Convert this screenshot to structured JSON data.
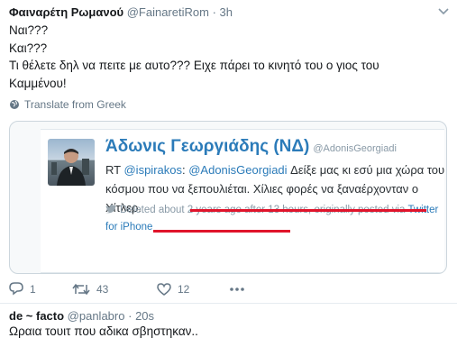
{
  "tweet1": {
    "name": "Φαιναρέτη Ρωμανού",
    "handle": "@FainaretiRom",
    "separator": "·",
    "time": "3h",
    "lines": [
      "Ναι???",
      "Και???",
      "Τι θέλετε δηλ να πειτε με αυτο??? Ειχε πάρει το κινητό του ο γιος του",
      "Καμμένου!"
    ],
    "translate": "Translate from Greek",
    "embedded": {
      "name": "Άδωνις Γεωργιάδης (ΝΔ)",
      "handle": "@AdonisGeorgiadi",
      "rt_prefix": "RT",
      "mention1": "@ispirakos",
      "colon": ":",
      "mention2": "@AdonisGeorgiadi",
      "text_part1": " Δείξε μας κι εσύ μια χώρα του Δυτικ",
      "text_part2": "κόσμου που να ξεπουλιέται. Χίλιες φορές να ξαναέρχονταν ο Χίτλερ.",
      "meta_part1": "Deleted about 2 years ago after 13 hours, originally posted via ",
      "meta_link": "Twitter for iPhone"
    },
    "actions": {
      "replies": "1",
      "retweets": "43",
      "likes": "12"
    }
  },
  "tweet2": {
    "name": "de ~ facto",
    "handle": "@panlabro",
    "separator": "·",
    "time": "20s",
    "text": "Ωραια τουιτ που αδικα σβηστηκαν.."
  },
  "colors": {
    "link": "#2b7bb9",
    "annotation": "#e0142b",
    "muted": "#657786"
  },
  "icons": [
    "chevron-down-icon",
    "globe-icon",
    "bird-icon",
    "reply-icon",
    "retweet-icon",
    "like-icon",
    "more-icon"
  ]
}
